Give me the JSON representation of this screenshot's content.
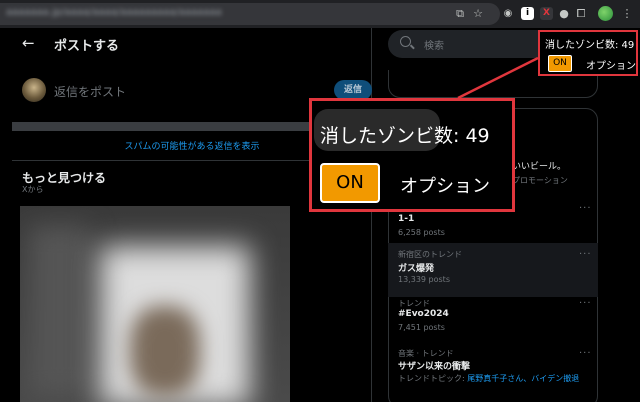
{
  "browser": {
    "url": "aaaaaaa.jp/aaaa/aaaa/aaaaaaaaa/aaaaaaa",
    "extension_badges": [
      "i",
      "X"
    ]
  },
  "header": {
    "title": "ポストする"
  },
  "reply": {
    "placeholder": "返信をポスト",
    "button_label": "返信"
  },
  "spam_link": "スパムの可能性がある返信を表示",
  "more": {
    "title": "もっと見つける",
    "subtitle": "Xから"
  },
  "search": {
    "placeholder": "検索"
  },
  "promo": {
    "text": "いいビール。",
    "subtext": "プロモーション"
  },
  "trends": [
    {
      "meta": "",
      "name": "1-1",
      "count": "6,258 posts"
    },
    {
      "meta": "新宿区のトレンド",
      "name": "ガス爆発",
      "count": "13,339 posts"
    },
    {
      "meta": "トレンド",
      "name": "#Evo2024",
      "count": "7,451 posts"
    },
    {
      "meta": "音楽 · トレンド",
      "name": "サザン以来の衝撃",
      "topics_label": "トレンドトピック:",
      "topics_links": "尾野真千子さん、バイデン撤退"
    }
  ],
  "overlay": {
    "counter_text": "消したゾンビ数: 49",
    "toggle_label": "ON",
    "options_label": "オプション",
    "accent_color": "#f29900",
    "frame_color": "#e0363d"
  }
}
